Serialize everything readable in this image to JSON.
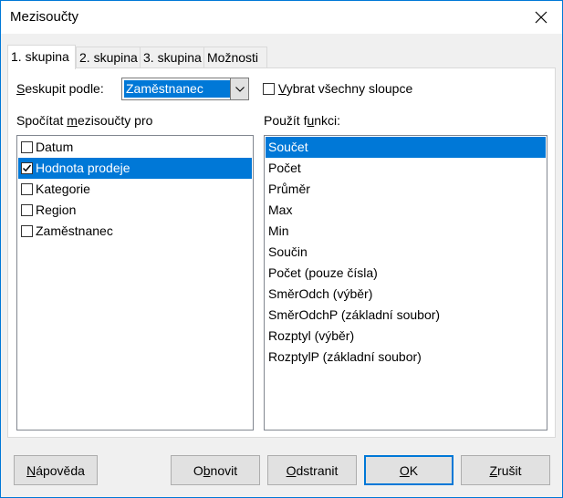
{
  "window": {
    "title": "Mezisoučty"
  },
  "tabs": [
    {
      "label": "1. skupina"
    },
    {
      "label": "2. skupina"
    },
    {
      "label": "3. skupina"
    },
    {
      "label": "Možnosti"
    }
  ],
  "group_by": {
    "label_ul": "S",
    "label_rest": "eskupit podle:",
    "selected": "Zaměstnanec"
  },
  "select_all": {
    "label_ul": "V",
    "label_rest": "ybrat všechny sloupce",
    "checked": false
  },
  "subtotals_for": {
    "label_pre": "Spočítat ",
    "label_ul": "m",
    "label_post": "ezisoučty pro",
    "items": [
      {
        "label": "Datum",
        "checked": false
      },
      {
        "label": "Hodnota prodeje",
        "checked": true,
        "selected": true
      },
      {
        "label": "Kategorie",
        "checked": false
      },
      {
        "label": "Region",
        "checked": false
      },
      {
        "label": "Zaměstnanec",
        "checked": false
      }
    ]
  },
  "use_function": {
    "label_pre": "Použít f",
    "label_ul": "u",
    "label_post": "nkci:",
    "items": [
      {
        "label": "Součet",
        "selected": true
      },
      {
        "label": "Počet"
      },
      {
        "label": "Průměr"
      },
      {
        "label": "Max"
      },
      {
        "label": "Min"
      },
      {
        "label": "Součin"
      },
      {
        "label": "Počet (pouze čísla)"
      },
      {
        "label": "SměrOdch (výběr)"
      },
      {
        "label": "SměrOdchP (základní soubor)"
      },
      {
        "label": "Rozptyl (výběr)"
      },
      {
        "label": "RozptylP (základní soubor)"
      }
    ]
  },
  "buttons": {
    "help": {
      "ul": "N",
      "rest": "ápověda"
    },
    "reset": {
      "pre": "O",
      "ul": "b",
      "rest": "novit"
    },
    "delete": {
      "ul": "O",
      "rest": "dstranit"
    },
    "ok": {
      "ul": "O",
      "rest": "K"
    },
    "cancel": {
      "ul": "Z",
      "rest": "rušit"
    }
  },
  "colors": {
    "accent": "#0078d7",
    "background": "#f0f0f0"
  }
}
